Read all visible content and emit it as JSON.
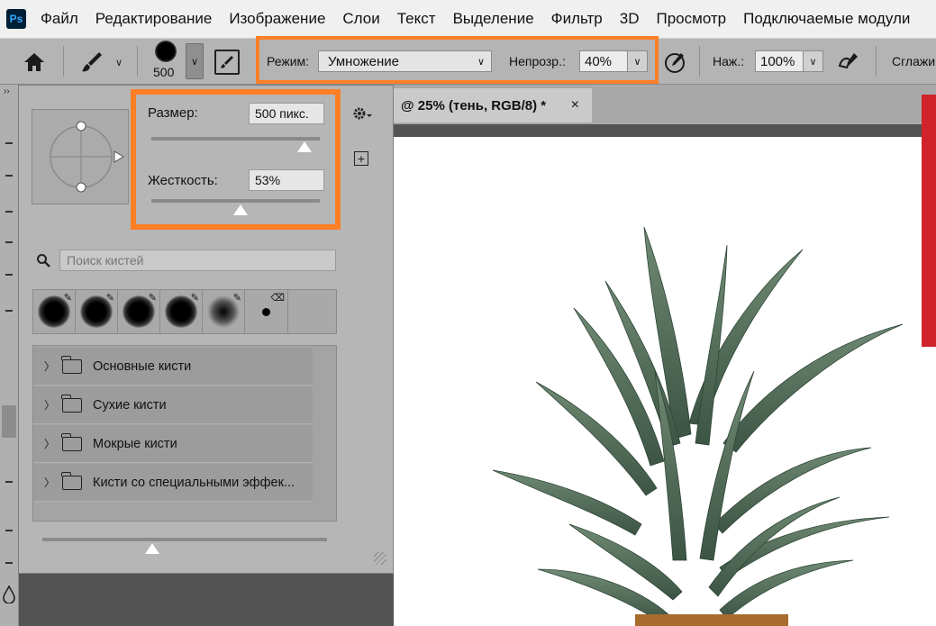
{
  "app": {
    "logo": "Ps"
  },
  "menu": [
    "Файл",
    "Редактирование",
    "Изображение",
    "Слои",
    "Текст",
    "Выделение",
    "Фильтр",
    "3D",
    "Просмотр",
    "Подключаемые модули"
  ],
  "options": {
    "brush_size": "500",
    "mode_label": "Режим:",
    "mode_value": "Умножение",
    "opacity_label": "Непрозр.:",
    "opacity_value": "40%",
    "flow_label": "Наж.:",
    "flow_value": "100%",
    "smoothing_label": "Сглажи"
  },
  "document": {
    "tab_title": "@ 25% (тень, RGB/8) *",
    "close_glyph": "×"
  },
  "brush_panel": {
    "size_label": "Размер:",
    "size_value": "500 пикс.",
    "hardness_label": "Жесткость:",
    "hardness_value": "53%",
    "search_placeholder": "Поиск кистей",
    "folders": [
      "Основные кисти",
      "Сухие кисти",
      "Мокрые кисти",
      "Кисти со специальными эффек..."
    ]
  },
  "colors": {
    "accent_highlight": "#ff7f27",
    "red_swatch": "#d1232a"
  }
}
